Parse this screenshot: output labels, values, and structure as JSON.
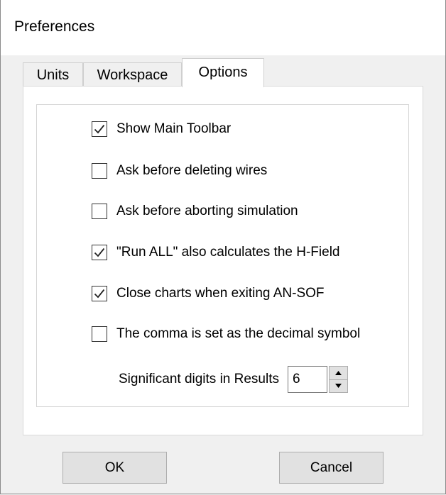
{
  "window": {
    "title": "Preferences"
  },
  "tabs": [
    {
      "label": "Units",
      "active": false
    },
    {
      "label": "Workspace",
      "active": false
    },
    {
      "label": "Options",
      "active": true
    }
  ],
  "options": [
    {
      "label": "Show Main Toolbar",
      "checked": true
    },
    {
      "label": "Ask before deleting wires",
      "checked": false
    },
    {
      "label": "Ask before aborting simulation",
      "checked": false
    },
    {
      "label": "\"Run ALL\" also calculates the H-Field",
      "checked": true
    },
    {
      "label": "Close charts when exiting AN-SOF",
      "checked": true
    },
    {
      "label": "The comma is set as the decimal symbol",
      "checked": false
    }
  ],
  "significant_digits": {
    "label": "Significant digits in Results",
    "value": "6"
  },
  "buttons": {
    "ok": "OK",
    "cancel": "Cancel"
  },
  "icons": {
    "check": "check-mark-icon",
    "spin_up": "arrow-up-icon",
    "spin_down": "arrow-down-icon"
  },
  "colors": {
    "window_bg": "#f0f0f0",
    "panel_bg": "#ffffff",
    "button_bg": "#e1e1e1"
  }
}
